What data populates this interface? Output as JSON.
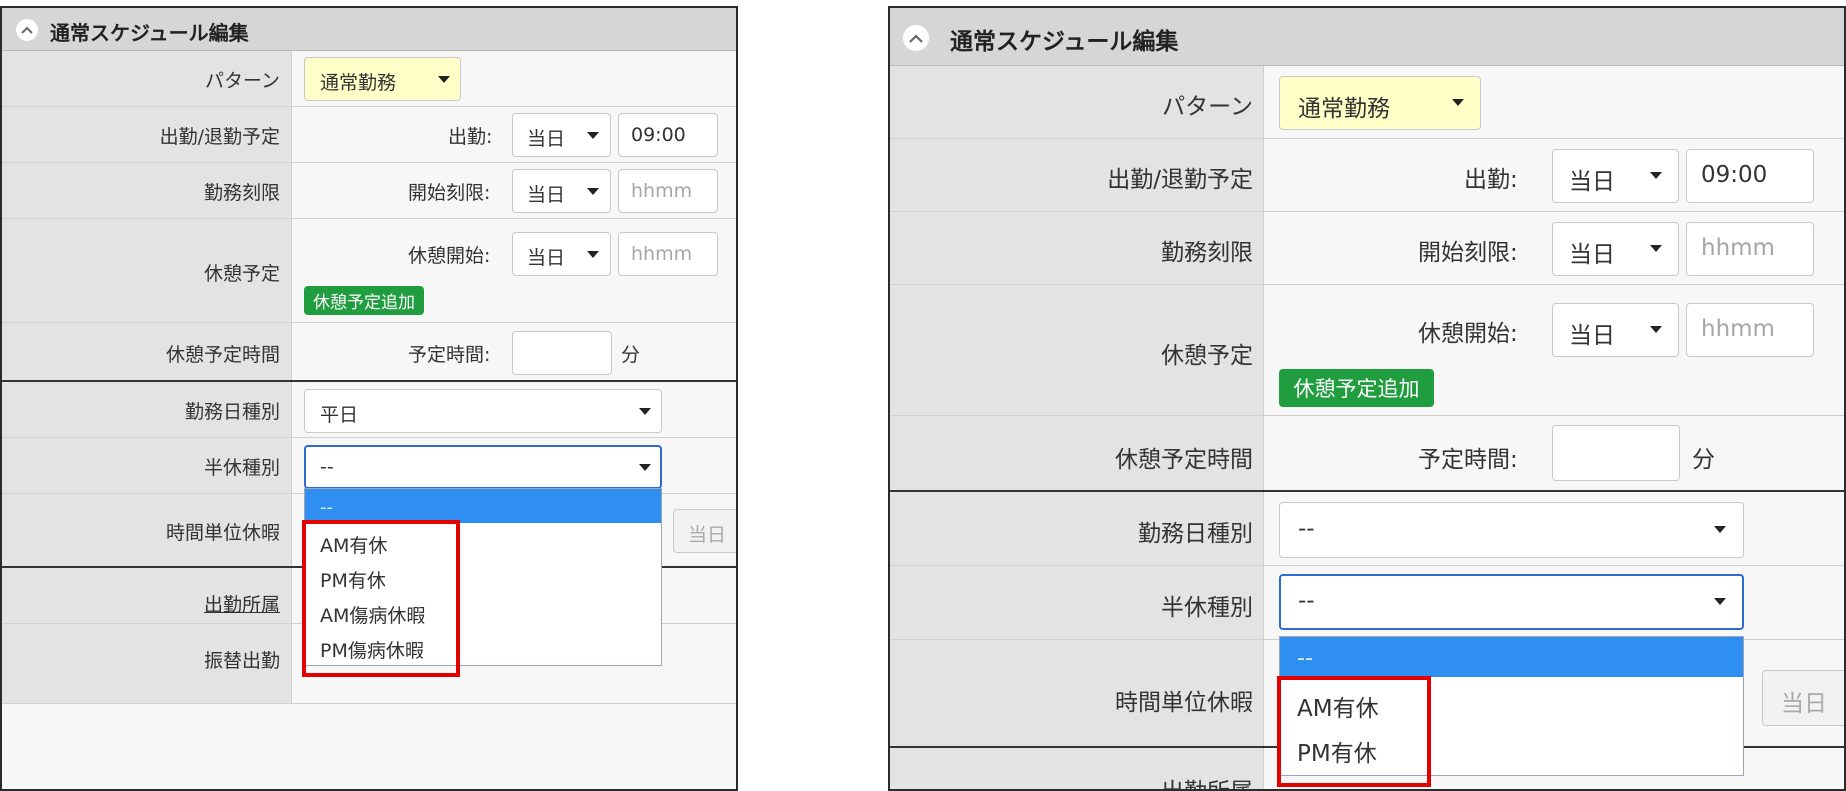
{
  "header_title": "通常スケジュール編集",
  "fields": {
    "pattern": {
      "label": "パターン",
      "value": "通常勤務"
    },
    "attendance": {
      "label": "出勤/退勤予定",
      "sub": "出勤:",
      "day": "当日",
      "time": "09:00"
    },
    "limit": {
      "label": "勤務刻限",
      "sub": "開始刻限:",
      "day": "当日",
      "placeholder": "hhmm"
    },
    "break": {
      "label": "休憩予定",
      "sub": "休憩開始:",
      "day": "当日",
      "placeholder": "hhmm",
      "add_button": "休憩予定追加"
    },
    "break_time": {
      "label": "休憩予定時間",
      "sub": "予定時間:",
      "unit": "分"
    },
    "workday_type": {
      "label": "勤務日種別"
    },
    "half_leave": {
      "label": "半休種別",
      "value": "--"
    },
    "hourly_leave": {
      "label": "時間単位休暇",
      "day": "当日"
    },
    "work_dept": {
      "label": "出勤所属"
    },
    "substitute": {
      "label": "振替出勤"
    }
  },
  "left": {
    "workday_value": "平日",
    "options": [
      "--",
      "AM有休",
      "PM有休",
      "AM傷病休暇",
      "PM傷病休暇"
    ]
  },
  "right": {
    "workday_value": "--",
    "options": [
      "--",
      "AM有休",
      "PM有休"
    ]
  },
  "colors": {
    "highlight": "#e30000",
    "selected_option": "#2f8ff0",
    "add_button": "#1f9d3f",
    "pattern_bg": "#ffffc7"
  }
}
